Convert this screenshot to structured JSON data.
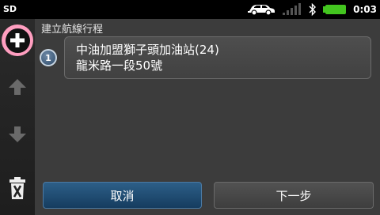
{
  "status_bar": {
    "storage": "SD",
    "time": "0:03",
    "icons": [
      "car-icon",
      "signal-icon",
      "bluetooth-icon",
      "battery-icon"
    ],
    "battery_color": "#43c51f"
  },
  "sidebar": {
    "buttons": [
      "add-icon",
      "arrow-up-icon",
      "arrow-down-icon",
      "trash-icon"
    ],
    "highlight_color": "#ff9ec0"
  },
  "page": {
    "title": "建立航線行程"
  },
  "route_items": [
    {
      "number": "1",
      "name": "中油加盟獅子頭加油站(24)",
      "address": "龍米路一段50號"
    }
  ],
  "buttons": {
    "cancel": "取消",
    "next": "下一步"
  },
  "colors": {
    "cancel_button": "#1f4d74",
    "next_button": "#494949",
    "background": "#3c3c3c"
  }
}
